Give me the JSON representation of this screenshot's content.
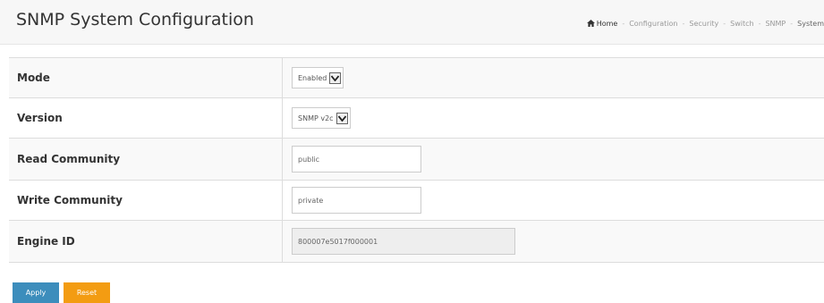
{
  "header": {
    "title": "SNMP System Configuration",
    "breadcrumb": [
      "Home",
      "Configuration",
      "Security",
      "Switch",
      "SNMP",
      "System"
    ]
  },
  "form": {
    "mode": {
      "label": "Mode",
      "value": "Enabled"
    },
    "version": {
      "label": "Version",
      "value": "SNMP v2c"
    },
    "read_community": {
      "label": "Read Community",
      "value": "public"
    },
    "write_community": {
      "label": "Write Community",
      "value": "private"
    },
    "engine_id": {
      "label": "Engine ID",
      "value": "800007e5017f000001"
    }
  },
  "buttons": {
    "apply": "Apply",
    "reset": "Reset"
  },
  "colors": {
    "apply": "#3c8dbc",
    "reset": "#f39c12"
  },
  "icons": {
    "home": "home-icon",
    "dropdown": "chevron-down-icon"
  }
}
